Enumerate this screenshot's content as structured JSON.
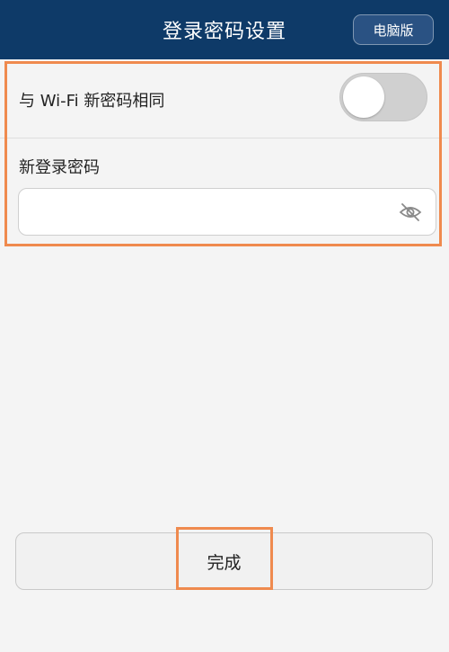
{
  "header": {
    "title": "登录密码设置",
    "desktop_button_label": "电脑版"
  },
  "form": {
    "same_as_wifi_label": "与 Wi-Fi 新密码相同",
    "same_as_wifi_enabled": false,
    "new_password_label": "新登录密码",
    "new_password_value": "",
    "visibility_icon": "eye-hidden-icon"
  },
  "footer": {
    "done_label": "完成"
  },
  "colors": {
    "header_bg": "#0e3a68",
    "highlight": "#ef8a4e",
    "page_bg": "#f4f4f4",
    "toggle_off": "#d0d0d0"
  }
}
